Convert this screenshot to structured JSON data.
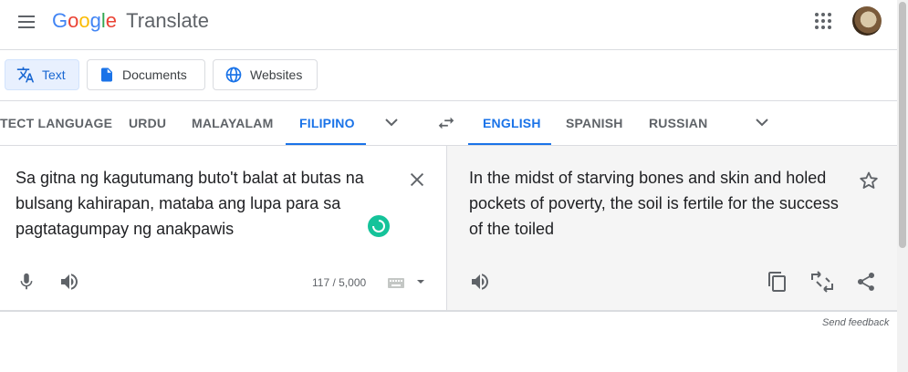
{
  "header": {
    "app_name_letters": [
      {
        "ch": "G",
        "color": "#4285F4"
      },
      {
        "ch": "o",
        "color": "#EA4335"
      },
      {
        "ch": "o",
        "color": "#FBBC05"
      },
      {
        "ch": "g",
        "color": "#4285F4"
      },
      {
        "ch": "l",
        "color": "#34A853"
      },
      {
        "ch": "e",
        "color": "#EA4335"
      }
    ],
    "product": "Translate"
  },
  "modes": [
    {
      "label": "Text",
      "icon": "translate-icon",
      "active": true
    },
    {
      "label": "Documents",
      "icon": "document-icon",
      "active": false
    },
    {
      "label": "Websites",
      "icon": "globe-icon",
      "active": false
    }
  ],
  "source_langs": {
    "tabs": [
      "TECT LANGUAGE",
      "URDU",
      "MALAYALAM",
      "FILIPINO"
    ],
    "active": "FILIPINO"
  },
  "target_langs": {
    "tabs": [
      "ENGLISH",
      "SPANISH",
      "RUSSIAN"
    ],
    "active": "ENGLISH"
  },
  "source": {
    "text": "Sa gitna ng kagutumang buto't balat at butas na bulsang kahirapan, mataba ang lupa para sa pagtatagumpay ng anakpawis",
    "char_count": "117 / 5,000"
  },
  "target": {
    "text": "In the midst of starving bones and skin and holed pockets of poverty, the soil is fertile for the success of the toiled"
  },
  "footer": {
    "send_feedback": "Send feedback"
  },
  "colors": {
    "accent": "#1a73e8",
    "grammarly": "#15c39a"
  }
}
